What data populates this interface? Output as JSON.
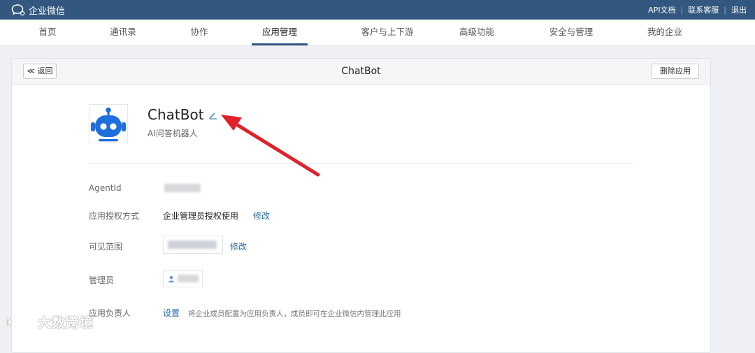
{
  "header": {
    "logo_text": "企业微信",
    "links": [
      "API文档",
      "联系客服",
      "退出"
    ]
  },
  "nav": {
    "items": [
      "首页",
      "通讯录",
      "协作",
      "应用管理",
      "客户与上下游",
      "高级功能",
      "安全与管理",
      "我的企业"
    ],
    "active_index": 3
  },
  "panel": {
    "back_label": "≪ 返回",
    "title": "ChatBot",
    "delete_label": "删除应用"
  },
  "app": {
    "name": "ChatBot",
    "description": "AI问答机器人",
    "icon": "robot-icon",
    "icon_color": "#1e6fdc"
  },
  "fields": {
    "agentid_label": "AgentId",
    "auth_label": "应用授权方式",
    "auth_value": "企业管理员授权使用",
    "auth_edit": "修改",
    "visible_label": "可见范围",
    "visible_edit": "修改",
    "admin_label": "管理员",
    "owner_label": "应用负责人",
    "owner_action": "设置",
    "owner_hint": "将企业成员配置为应用负责人，成员即可在企业微信内管理此应用"
  },
  "watermark": {
    "text": "大数跨境"
  },
  "colors": {
    "topbar": "#33587f",
    "link": "#2b6aa8",
    "annotation_arrow": "#e0202a"
  }
}
